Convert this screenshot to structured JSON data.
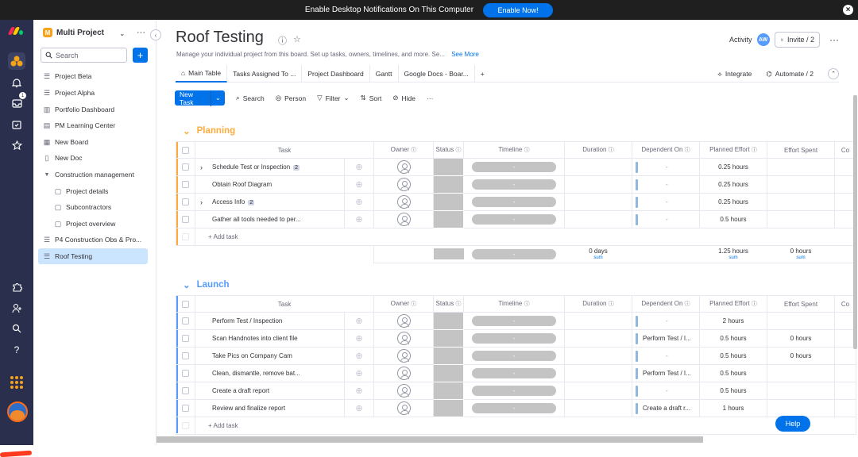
{
  "notification": {
    "text": "Enable Desktop Notifications On This Computer",
    "button": "Enable Now!",
    "close": "×"
  },
  "rail": {
    "logo_colors": [
      "#f62b54",
      "#ffcb00",
      "#00ca72"
    ],
    "icons": [
      "bell-icon",
      "inbox-icon",
      "calendar-icon",
      "star-icon",
      "puzzle-icon",
      "add-user-icon",
      "search-icon",
      "help-icon",
      "apps-grid-icon"
    ],
    "inbox_badge": "1"
  },
  "sidebar": {
    "workspace_letter": "M",
    "workspace_name": "Multi Project",
    "search_placeholder": "Search",
    "add": "+",
    "items": [
      {
        "label": "Project Beta",
        "icon": "board-icon"
      },
      {
        "label": "Project Alpha",
        "icon": "board-icon"
      },
      {
        "label": "Portfolio Dashboard",
        "icon": "dashboard-icon"
      },
      {
        "label": "PM Learning Center",
        "icon": "doc-icon"
      },
      {
        "label": "New Board",
        "icon": "board-icon"
      },
      {
        "label": "New Doc",
        "icon": "doc-icon"
      },
      {
        "label": "Construction management",
        "icon": "folder-caret-icon"
      },
      {
        "label": "Project details",
        "icon": "doc-icon"
      },
      {
        "label": "Subcontractors",
        "icon": "doc-icon"
      },
      {
        "label": "Project overview",
        "icon": "doc-icon"
      },
      {
        "label": "P4 Construction Obs & Pro...",
        "icon": "board-icon"
      },
      {
        "label": "Roof Testing",
        "icon": "board-icon"
      }
    ]
  },
  "board": {
    "title": "Roof Testing",
    "description": "Manage your individual project from this board. Set up tasks, owners, timelines, and more. Se...",
    "see_more": "See More",
    "activity": "Activity",
    "activity_avatar": "AW",
    "invite": "Invite / 2",
    "more": "···"
  },
  "tabs": {
    "items": [
      "Main Table",
      "Tasks Assigned To ...",
      "Project Dashboard",
      "Gantt",
      "Google Docs - Boar..."
    ],
    "add": "+",
    "integrate": "Integrate",
    "automate": "Automate / 2"
  },
  "toolbar": {
    "new_task": "New Task",
    "search": "Search",
    "person": "Person",
    "filter": "Filter",
    "sort": "Sort",
    "hide": "Hide",
    "more": "···"
  },
  "columns": [
    "Task",
    "Owner",
    "Status",
    "Timeline",
    "Duration",
    "Dependent On",
    "Planned Effort",
    "Effort Spent",
    "Co"
  ],
  "groups": [
    {
      "name": "Planning",
      "color": "#fdab3d",
      "rows": [
        {
          "task": "Schedule Test or Inspection",
          "badge": "2",
          "expand": true,
          "timeline": "-",
          "dependent": "-",
          "planned": "0.25 hours",
          "spent": ""
        },
        {
          "task": "Obtain Roof Diagram",
          "badge": "",
          "expand": false,
          "timeline": "-",
          "dependent": "-",
          "planned": "0.25 hours",
          "spent": ""
        },
        {
          "task": "Access Info",
          "badge": "2",
          "expand": true,
          "timeline": "-",
          "dependent": "-",
          "planned": "0.25 hours",
          "spent": ""
        },
        {
          "task": "Gather all tools needed to per...",
          "badge": "",
          "expand": false,
          "timeline": "-",
          "dependent": "-",
          "planned": "0.5 hours",
          "spent": ""
        }
      ],
      "add_task": "+ Add task",
      "summary": {
        "timeline": "-",
        "duration": "0 days",
        "duration_label": "sum",
        "planned": "1.25 hours",
        "planned_label": "sum",
        "spent": "0 hours",
        "spent_label": "sum"
      }
    },
    {
      "name": "Launch",
      "color": "#579bfc",
      "rows": [
        {
          "task": "Perform Test / Inspection",
          "badge": "",
          "expand": false,
          "timeline": "-",
          "dependent": "-",
          "planned": "2 hours",
          "spent": ""
        },
        {
          "task": "Scan Handnotes into client file",
          "badge": "",
          "expand": false,
          "timeline": "-",
          "dependent": "Perform Test / I...",
          "planned": "0.5 hours",
          "spent": "0 hours"
        },
        {
          "task": "Take Pics on Company Cam",
          "badge": "",
          "expand": false,
          "timeline": "-",
          "dependent": "-",
          "planned": "0.5 hours",
          "spent": "0 hours"
        },
        {
          "task": "Clean, dismantle, remove bat...",
          "badge": "",
          "expand": false,
          "timeline": "-",
          "dependent": "Perform Test / I...",
          "planned": "0.5 hours",
          "spent": ""
        },
        {
          "task": "Create a draft report",
          "badge": "",
          "expand": false,
          "timeline": "-",
          "dependent": "-",
          "planned": "0.5 hours",
          "spent": ""
        },
        {
          "task": "Review and finalize report",
          "badge": "",
          "expand": false,
          "timeline": "-",
          "dependent": "Create a draft r...",
          "planned": "1 hours",
          "spent": ""
        }
      ],
      "add_task": "+ Add task"
    }
  ],
  "help": "Help"
}
